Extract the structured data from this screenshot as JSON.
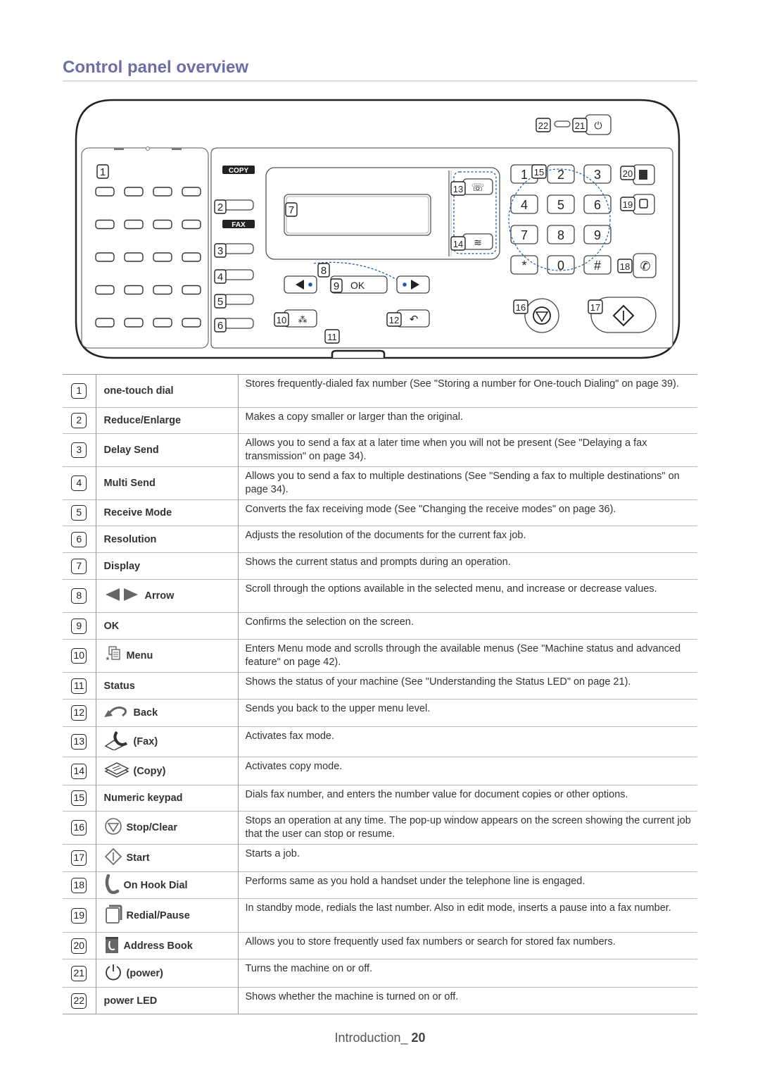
{
  "page": {
    "title": "Control panel overview",
    "footer_section": "Introduction_",
    "footer_page": "20"
  },
  "panel": {
    "copy_label": "COPY",
    "fax_label": "FAX",
    "ok_label": "OK",
    "keypad": [
      "1",
      "2",
      "3",
      "4",
      "5",
      "6",
      "7",
      "8",
      "9",
      "*",
      "0",
      "#"
    ],
    "callouts": [
      "1",
      "2",
      "3",
      "4",
      "5",
      "6",
      "7",
      "8",
      "9",
      "10",
      "11",
      "12",
      "13",
      "14",
      "15",
      "16",
      "17",
      "18",
      "19",
      "20",
      "21",
      "22"
    ],
    "accent_color": "#1f5aa6"
  },
  "table": {
    "rows": [
      {
        "num": "1",
        "name": "one-touch dial",
        "icon": "",
        "desc": "Stores frequently-dialed fax number (See \"Storing a number for One-touch Dialing\" on page 39)."
      },
      {
        "num": "2",
        "name": "Reduce/Enlarge",
        "icon": "",
        "desc": "Makes a copy smaller or larger than the original."
      },
      {
        "num": "3",
        "name": "Delay Send",
        "icon": "",
        "desc": "Allows you to send a fax at a later time when you will not be present (See \"Delaying a fax transmission\" on page 34)."
      },
      {
        "num": "4",
        "name": "Multi Send",
        "icon": "",
        "desc": "Allows you to send a fax to multiple destinations (See \"Sending a fax to multiple destinations\" on page 34)."
      },
      {
        "num": "5",
        "name": "Receive Mode",
        "icon": "",
        "desc": "Converts the fax receiving mode (See \"Changing the receive modes\" on page 36)."
      },
      {
        "num": "6",
        "name": "Resolution",
        "icon": "",
        "desc": "Adjusts the resolution of the documents for the current fax job."
      },
      {
        "num": "7",
        "name": "Display",
        "icon": "",
        "desc": "Shows the current status and prompts during an operation."
      },
      {
        "num": "8",
        "name": "Arrow",
        "icon": "arrow-left-right-icon",
        "desc": "Scroll through the options available in the selected menu, and increase or decrease values."
      },
      {
        "num": "9",
        "name": "OK",
        "icon": "",
        "desc": "Confirms the selection on the screen."
      },
      {
        "num": "10",
        "name": "Menu",
        "icon": "menu-icon",
        "desc": "Enters Menu mode and scrolls through the available menus (See \"Machine status and advanced feature\" on page 42)."
      },
      {
        "num": "11",
        "name": "Status",
        "icon": "",
        "desc": "Shows the status of your machine (See \"Understanding the Status LED\" on page 21)."
      },
      {
        "num": "12",
        "name": "Back",
        "icon": "back-arrow-icon",
        "desc": "Sends you back to the upper menu level."
      },
      {
        "num": "13",
        "name": "(Fax)",
        "icon": "fax-icon",
        "desc": "Activates fax mode."
      },
      {
        "num": "14",
        "name": "(Copy)",
        "icon": "copy-icon",
        "desc": "Activates copy mode."
      },
      {
        "num": "15",
        "name": "Numeric keypad",
        "icon": "",
        "desc": "Dials fax number, and enters the number value for document copies or other options."
      },
      {
        "num": "16",
        "name": "Stop/Clear",
        "icon": "stop-icon",
        "desc": "Stops an operation at any time. The pop-up window appears on the screen showing the current job that the user can stop or resume."
      },
      {
        "num": "17",
        "name": "Start",
        "icon": "start-icon",
        "desc": "Starts a job."
      },
      {
        "num": "18",
        "name": "On Hook Dial",
        "icon": "phone-icon",
        "desc": "Performs same as you hold a handset under the telephone line is engaged."
      },
      {
        "num": "19",
        "name": "Redial/Pause",
        "icon": "redial-icon",
        "desc": "In standby mode, redials the last number. Also in edit mode, inserts a pause into a fax number."
      },
      {
        "num": "20",
        "name": "Address Book",
        "icon": "address-book-icon",
        "desc": "Allows you to store frequently used fax numbers or search for stored fax numbers."
      },
      {
        "num": "21",
        "name": "(power)",
        "icon": "power-icon",
        "desc": "Turns the machine on or off."
      },
      {
        "num": "22",
        "name": "power LED",
        "icon": "",
        "desc": "Shows whether the machine is turned on or off."
      }
    ]
  }
}
